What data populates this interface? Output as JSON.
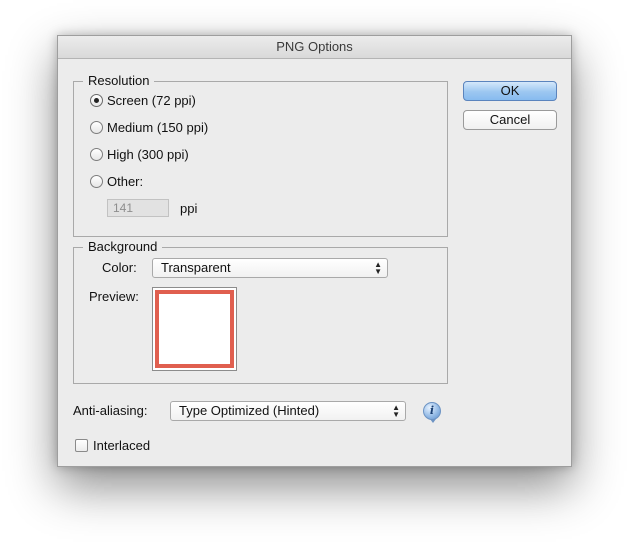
{
  "dialog": {
    "title": "PNG Options"
  },
  "resolution": {
    "title": "Resolution",
    "options": [
      {
        "label": "Screen (72 ppi)",
        "selected": true
      },
      {
        "label": "Medium (150 ppi)",
        "selected": false
      },
      {
        "label": "High (300 ppi)",
        "selected": false
      },
      {
        "label": "Other:",
        "selected": false
      }
    ],
    "other_value": "141",
    "unit": "ppi"
  },
  "background": {
    "title": "Background",
    "color_label": "Color:",
    "color_value": "Transparent",
    "preview_label": "Preview:",
    "preview_border_color": "#e05f4f"
  },
  "anti_aliasing": {
    "label": "Anti-aliasing:",
    "value": "Type Optimized (Hinted)",
    "info_icon": "info-icon"
  },
  "interlaced": {
    "label": "Interlaced",
    "checked": false
  },
  "buttons": {
    "ok": "OK",
    "cancel": "Cancel"
  }
}
